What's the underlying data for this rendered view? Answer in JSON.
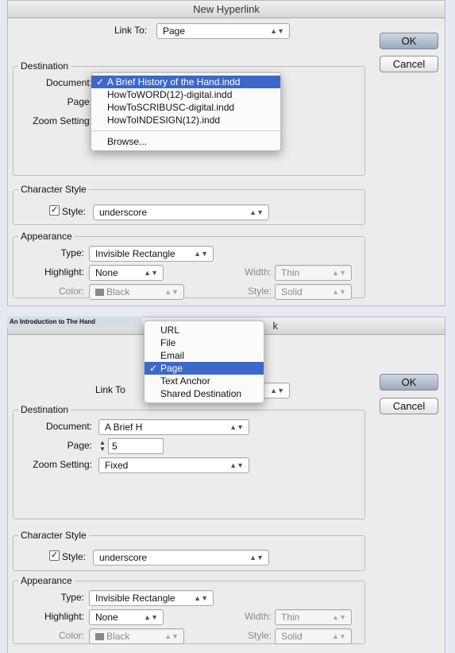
{
  "top": {
    "title": "New Hyperlink",
    "link_to_label": "Link To:",
    "link_to_value": "Page",
    "ok": "OK",
    "cancel": "Cancel",
    "destination_group": "Destination",
    "document_label": "Document:",
    "page_label": "Page:",
    "zoom_label": "Zoom Setting:",
    "document_menu": {
      "items": [
        "A Brief History of the Hand.indd",
        "HowToWORD(12)-digital.indd",
        "HowToSCRIBUSC-digital.indd",
        "HowToINDESIGN(12).indd"
      ],
      "selected": "A Brief History of the Hand.indd",
      "browse": "Browse..."
    },
    "character_style_group": "Character Style",
    "style_label": "Style:",
    "style_value": "underscore",
    "style_checked": true,
    "appearance_group": "Appearance",
    "type_label": "Type:",
    "type_value": "Invisible Rectangle",
    "highlight_label": "Highlight:",
    "highlight_value": "None",
    "width_label": "Width:",
    "width_value": "Thin",
    "color_label": "Color:",
    "color_value": "Black",
    "border_style_label": "Style:",
    "border_style_value": "Solid"
  },
  "bottom": {
    "hint_text": "An Introduction to The Hand",
    "title_fragment": "k",
    "link_to_label": "Link To",
    "link_to_menu": {
      "items": [
        "URL",
        "File",
        "Email",
        "Page",
        "Text Anchor",
        "Shared Destination"
      ],
      "selected": "Page"
    },
    "ok": "OK",
    "cancel": "Cancel",
    "destination_group": "Destination",
    "document_label": "Document:",
    "document_value": "A Brief H",
    "page_label": "Page:",
    "page_value": "5",
    "zoom_label": "Zoom Setting:",
    "zoom_value": "Fixed",
    "character_style_group": "Character Style",
    "style_label": "Style:",
    "style_value": "underscore",
    "style_checked": true,
    "appearance_group": "Appearance",
    "type_label": "Type:",
    "type_value": "Invisible Rectangle",
    "highlight_label": "Highlight:",
    "highlight_value": "None",
    "width_label": "Width:",
    "width_value": "Thin",
    "color_label": "Color:",
    "color_value": "Black",
    "border_style_label": "Style:",
    "border_style_value": "Solid"
  }
}
